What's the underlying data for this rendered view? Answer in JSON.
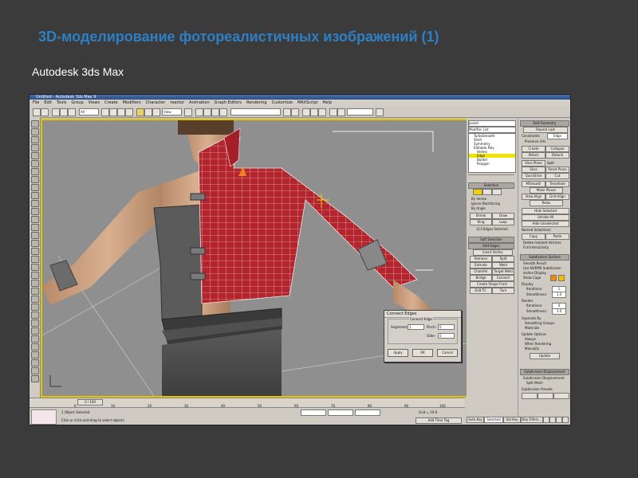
{
  "slide": {
    "title": "3D-моделирование фотореалистичных изображений (1)",
    "subtitle": "Autodesk 3ds Max"
  },
  "app": {
    "window_title": "Untitled - Autodesk 3ds Max 9",
    "menu": [
      "File",
      "Edit",
      "Tools",
      "Group",
      "Views",
      "Create",
      "Modifiers",
      "Character",
      "reactor",
      "Animation",
      "Graph Editors",
      "Rendering",
      "Customize",
      "MAXScript",
      "Help"
    ],
    "toolbar_dropdown_all": "All",
    "toolbar_dropdown_view": "View"
  },
  "command_panel": {
    "object_name": "Jacket",
    "modifier_list": "Modifier List",
    "stack": [
      "TurboSmooth",
      "Shell",
      "Symmetry",
      "Editable Poly",
      "Vertex",
      "Edge",
      "Border",
      "Polygon"
    ],
    "selection_title": "Selection",
    "by_vertex": "By Vertex",
    "ignore_backfacing": "Ignore Backfacing",
    "by_angle": "By Angle",
    "shrink": "Shrink",
    "grow": "Grow",
    "ring": "Ring",
    "loop": "Loop",
    "selection_status": "113 Edges Selected",
    "soft_selection_title": "Soft Selection",
    "edit_edges_title": "Edit Edges",
    "insert_vertex": "Insert Vertex",
    "remove": "Remove",
    "split": "Split",
    "extrude": "Extrude",
    "weld": "Weld",
    "chamfer": "Chamfer",
    "target_weld": "Target Weld",
    "bridge": "Bridge",
    "connect": "Connect",
    "create_shape": "Create Shape From Selection",
    "edit_tri": "Edit Tri.",
    "turn": "Turn"
  },
  "modify_panel": {
    "edit_geometry_title": "Edit Geometry",
    "repeat_last": "Repeat Last",
    "constraints": "Constraints",
    "constraint_value": "Edge",
    "preserve_uvs": "Preserve UVs",
    "create": "Create",
    "collapse": "Collapse",
    "attach": "Attach",
    "detach": "Detach",
    "slice_plane": "Slice Plane",
    "split": "Split",
    "slice": "Slice",
    "reset_plane": "Reset Plane",
    "quickslice": "QuickSlice",
    "cut": "Cut",
    "msmooth": "MSmooth",
    "tessellate": "Tessellate",
    "make_planar": "Make Planar",
    "view_align": "View Align",
    "grid_align": "Grid Align",
    "relax": "Relax",
    "hide_selected": "Hide Selected",
    "unhide_all": "Unhide All",
    "hide_unselected": "Hide Unselected",
    "named_selections": "Named Selections:",
    "copy": "Copy",
    "paste": "Paste",
    "delete_isolated": "Delete Isolated Vertices",
    "full_interactivity": "Full Interactivity",
    "subdivision_surface_title": "Subdivision Surface",
    "smooth_result": "Smooth Result",
    "use_nurms": "Use NURMS Subdivision",
    "isoline_display": "Isoline Display",
    "show_cage": "Show Cage",
    "display_label": "Display",
    "iterations": "Iterations:",
    "iterations_val": "1",
    "smoothness": "Smoothness:",
    "smoothness_val": "1.0",
    "render_label": "Render",
    "iterations_r_val": "0",
    "smoothness_r_val": "1.0",
    "separate_by": "Separate By",
    "smoothing_groups": "Smoothing Groups",
    "materials": "Materials",
    "update_options": "Update Options",
    "always": "Always",
    "when_rendering": "When Rendering",
    "manually": "Manually",
    "update": "Update",
    "subdivision_displacement_title": "Subdivision Displacement",
    "subdivision_displacement": "Subdivision Displacement",
    "split_mesh": "Split Mesh",
    "subdivision_presets": "Subdivision Presets"
  },
  "dialog": {
    "title": "Connect Edges",
    "group_title": "Connect Edge",
    "segments_label": "Segments:",
    "segments_val": "1",
    "pinch_label": "Pinch:",
    "pinch_val": "0",
    "slide_label": "Slide:",
    "slide_val": "0",
    "apply": "Apply",
    "ok": "OK",
    "cancel": "Cancel"
  },
  "timeline": {
    "frame_counter": "0 / 100",
    "ticks": [
      "0",
      "10",
      "20",
      "30",
      "40",
      "50",
      "60",
      "70",
      "80",
      "90",
      "100"
    ]
  },
  "status": {
    "selected": "1 Object Selected",
    "prompt": "Click or click-and-drag to select objects",
    "grid": "Grid = 10.0",
    "auto_key": "Auto Key",
    "set_key": "Set Key",
    "selected_dd": "Selected",
    "add_time_tag": "Add Time Tag",
    "key_filters": "Key Filters..."
  },
  "colors": {
    "slide_bg": "#3b3b3b",
    "title_blue": "#2e7fc4",
    "viewport_border": "#e2c400",
    "jacket_red": "#b3242d",
    "viewport_bg": "#8f8f8f"
  }
}
